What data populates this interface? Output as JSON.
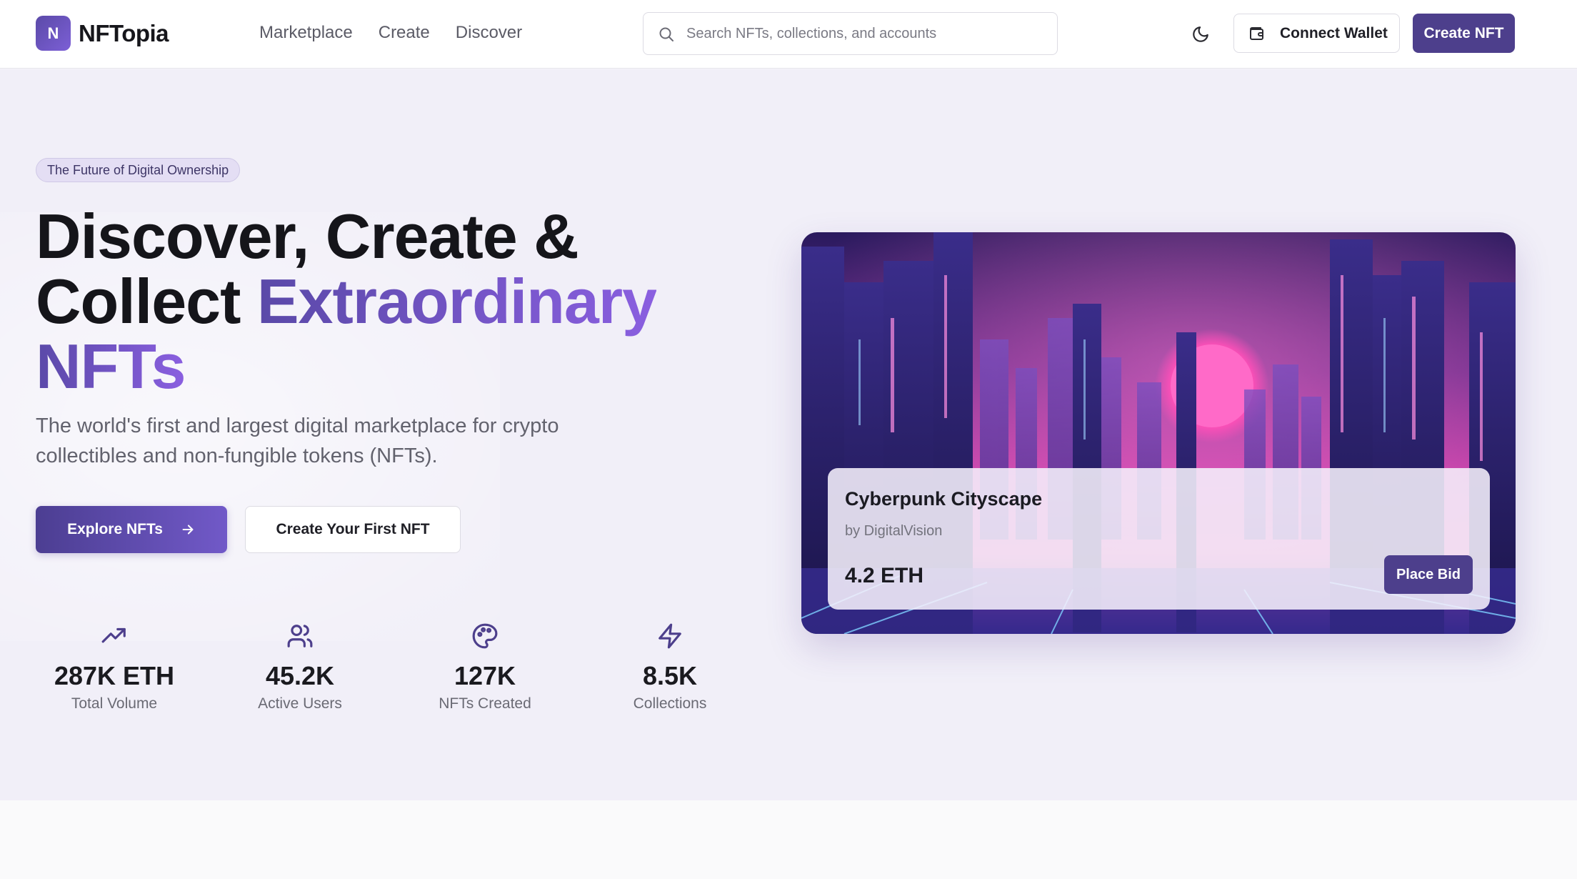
{
  "brand": {
    "logo_letter": "N",
    "name": "NFTopia",
    "accent": "#4d3f8c"
  },
  "nav": {
    "items": [
      {
        "label": "Marketplace"
      },
      {
        "label": "Create"
      },
      {
        "label": "Discover"
      }
    ]
  },
  "search": {
    "placeholder": "Search NFTs, collections, and accounts",
    "value": ""
  },
  "header_actions": {
    "connect_wallet": "Connect Wallet",
    "create_nft": "Create NFT",
    "theme_icon": "moon-icon",
    "wallet_icon": "wallet-icon"
  },
  "hero": {
    "badge": "The Future of Digital Ownership",
    "headline_line1": "Discover, Create &",
    "headline_line2_plain": "Collect ",
    "headline_line2_accent": "Extraordinary",
    "headline_line3_accent": "NFTs",
    "subtitle": "The world's first and largest digital marketplace for crypto collectibles and non-fungible tokens (NFTs).",
    "primary_cta": "Explore NFTs",
    "secondary_cta": "Create Your First NFT"
  },
  "stats": [
    {
      "icon": "trending-up-icon",
      "value": "287K ETH",
      "label": "Total Volume"
    },
    {
      "icon": "users-icon",
      "value": "45.2K",
      "label": "Active Users"
    },
    {
      "icon": "palette-icon",
      "value": "127K",
      "label": "NFTs Created"
    },
    {
      "icon": "zap-icon",
      "value": "8.5K",
      "label": "Collections"
    }
  ],
  "featured_nft": {
    "title": "Cyberpunk Cityscape",
    "creator": "by DigitalVision",
    "price": "4.2 ETH",
    "action": "Place Bid"
  }
}
